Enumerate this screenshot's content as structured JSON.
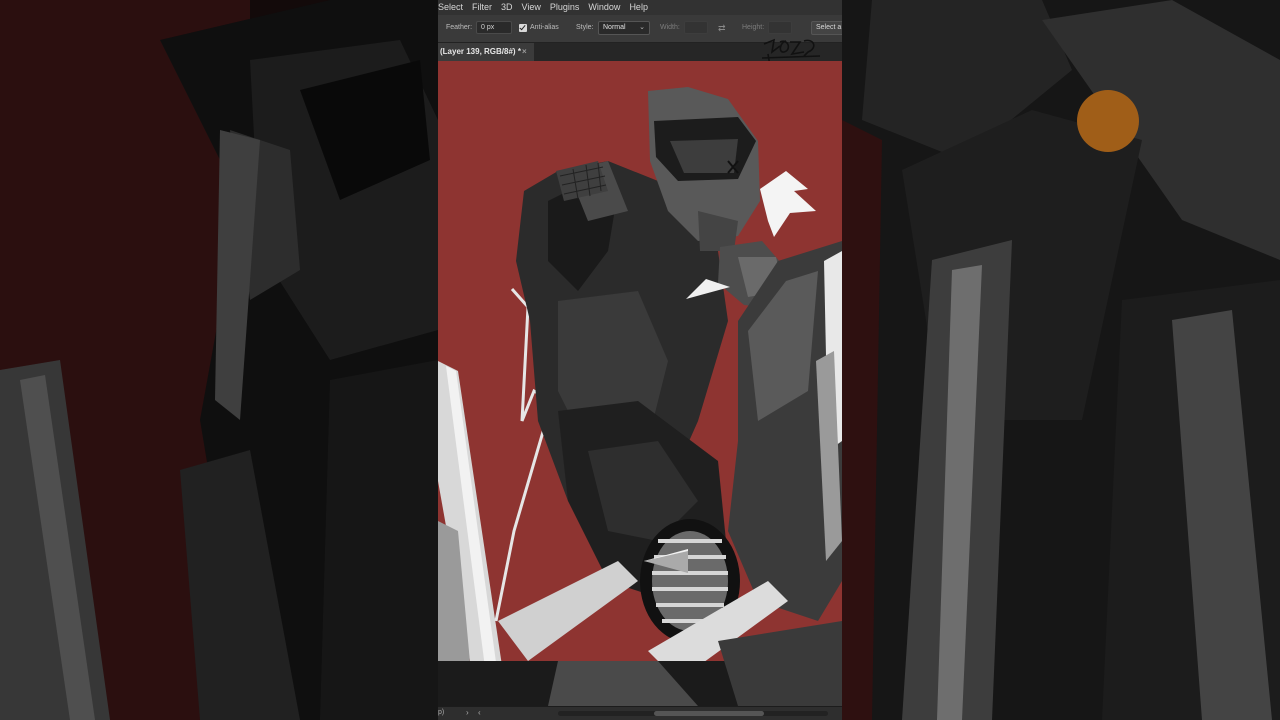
{
  "menu": [
    "Select",
    "Filter",
    "3D",
    "View",
    "Plugins",
    "Window",
    "Help"
  ],
  "options_bar": {
    "feather_label": "Feather:",
    "feather_value": "0 px",
    "antialias_label": "Anti-alias",
    "style_label": "Style:",
    "style_value": "Normal",
    "width_label": "Width:",
    "height_label": "Height:",
    "select_button": "Select a"
  },
  "document_tab": {
    "title": "(Layer 139, RGB/8#) *",
    "close": "×"
  },
  "status_bar": {
    "text": "p)",
    "arrow": "›",
    "scroll_left": "‹"
  },
  "colors": {
    "canvas_bg": "#8e3431",
    "accent_orange": "#e98c2b",
    "rider_dark": "#2a2a2a",
    "rider_mid": "#4a4a4a",
    "chrome": "#d8d8d8"
  },
  "icons": [
    "checkbox-checked-icon",
    "chevron-down-icon",
    "swap-arrows-icon",
    "close-icon",
    "chevron-right-icon",
    "chevron-left-icon"
  ]
}
